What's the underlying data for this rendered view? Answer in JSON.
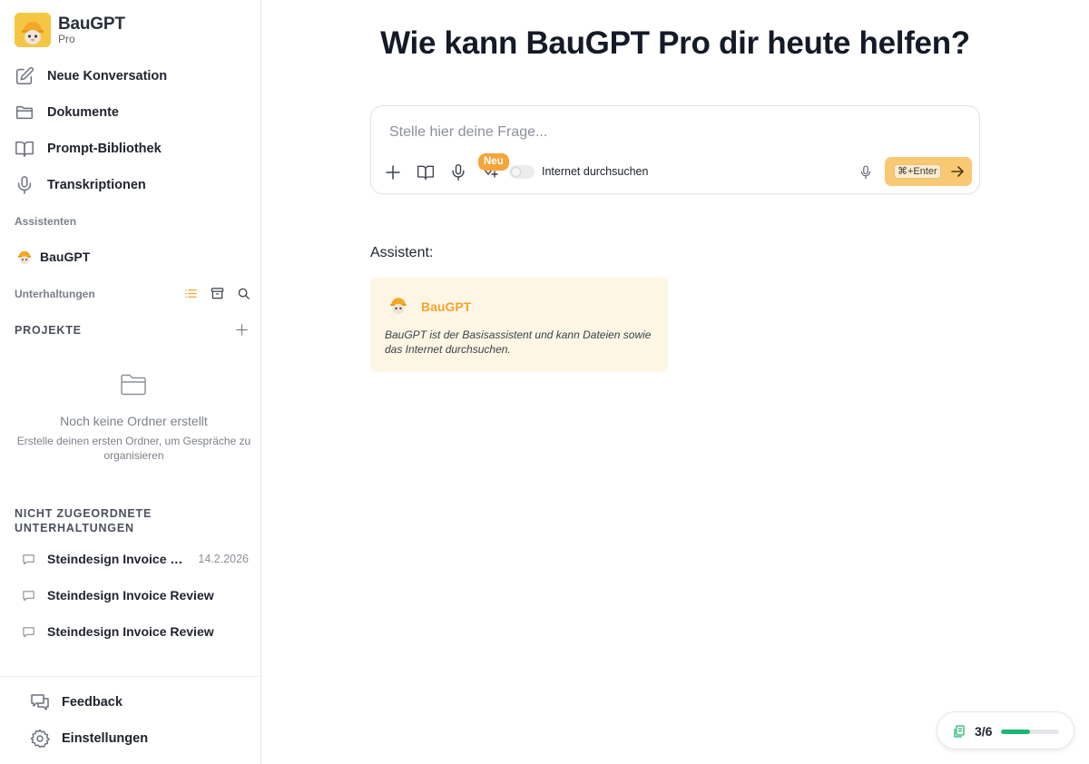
{
  "brand": {
    "name": "BauGPT",
    "tier": "Pro"
  },
  "nav": [
    {
      "label": "Neue Konversation",
      "icon": "edit-icon"
    },
    {
      "label": "Dokumente",
      "icon": "folder-icon"
    },
    {
      "label": "Prompt-Bibliothek",
      "icon": "book-icon"
    },
    {
      "label": "Transkriptionen",
      "icon": "microphone-icon"
    }
  ],
  "sections": {
    "assistants": "Assistenten",
    "conversations": "Unterhaltungen",
    "projects": "PROJEKTE",
    "unassigned": "NICHT ZUGEORDNETE UNTERHALTUNGEN"
  },
  "assistant_item": "BauGPT",
  "empty_projects": {
    "title": "Noch keine Ordner erstellt",
    "description": "Erstelle deinen ersten Ordner, um Gespräche zu organisieren"
  },
  "conversations": [
    {
      "title": "Steindesign Invoice Review",
      "date": "14.2.2026"
    },
    {
      "title": "Steindesign Invoice Review",
      "date": ""
    },
    {
      "title": "Steindesign Invoice Review",
      "date": ""
    }
  ],
  "footer": {
    "feedback": "Feedback",
    "settings": "Einstellungen"
  },
  "main": {
    "headline": "Wie kann BauGPT Pro dir heute helfen?",
    "input_placeholder": "Stelle hier deine Frage...",
    "badge_new": "Neu",
    "internet_toggle_label": "Internet durchsuchen",
    "internet_toggle_on": false,
    "send_shortcut": "⌘+Enter",
    "assistant_label": "Assistent:",
    "assistant_card": {
      "name": "BauGPT",
      "description": "BauGPT ist der Basisassistent und kann Dateien sowie das Internet durchsuchen."
    }
  },
  "usage": {
    "used": 3,
    "total": 6,
    "text": "3/6"
  },
  "colors": {
    "accent": "#f5a43a",
    "send_button": "#f9c872",
    "card_bg": "#fef6e4",
    "progress": "#1fb572",
    "logo_bg": "#f5c643"
  }
}
